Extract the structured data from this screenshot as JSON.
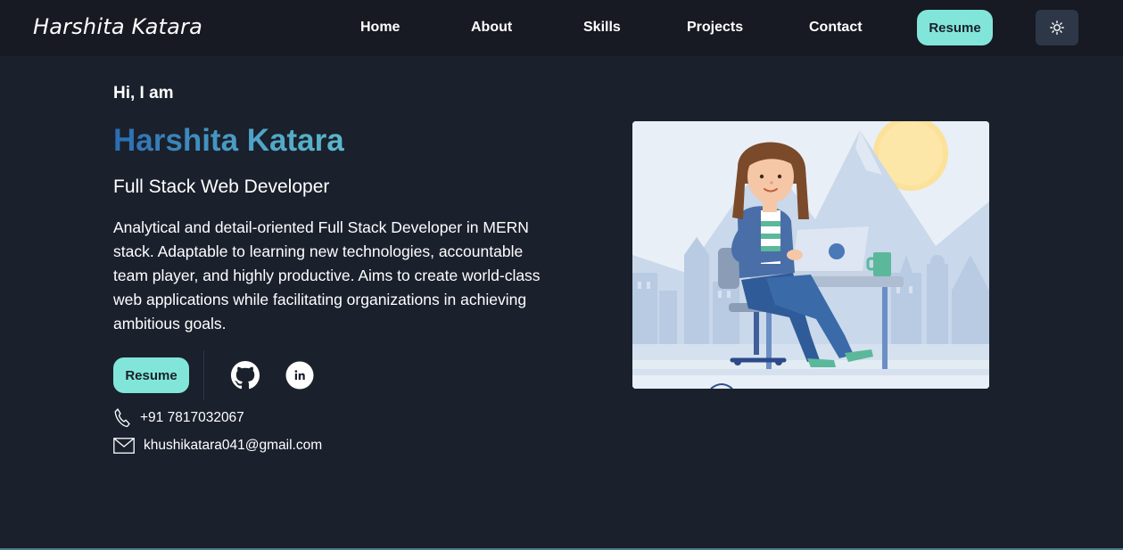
{
  "navbar": {
    "brand": "Harshita Katara",
    "links": [
      "Home",
      "About",
      "Skills",
      "Projects",
      "Contact"
    ],
    "resume_label": "Resume",
    "theme_icon": "sun-icon"
  },
  "hero": {
    "greeting": "Hi, I am",
    "name": "Harshita Katara",
    "role": "Full Stack Web Developer",
    "bio": "Analytical and detail-oriented Full Stack Developer in MERN stack. Adaptable to learning new technologies, accountable team player, and highly productive. Aims to create world-class web applications while facilitating organizations in achieving ambitious goals.",
    "resume_label": "Resume",
    "socials": [
      "github-icon",
      "linkedin-icon"
    ],
    "phone": "+91 7817032067",
    "email": "khushikatara041@gmail.com"
  },
  "colors": {
    "background": "#1a202c",
    "navbar": "#171923",
    "accent": "#81e6d9",
    "name_gradient_start": "#2b6cb0",
    "name_gradient_end": "#5bb8c9"
  }
}
